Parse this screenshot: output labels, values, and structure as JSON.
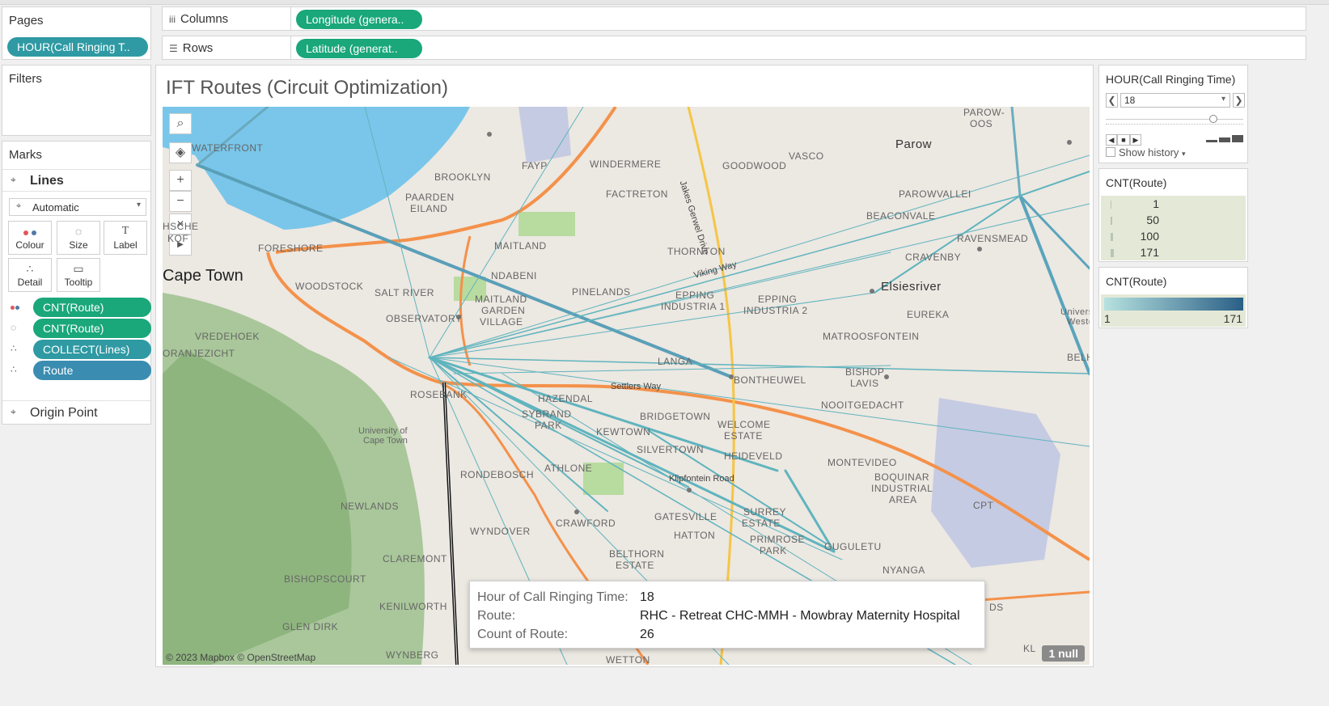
{
  "shelves": {
    "pages": {
      "label": "Pages",
      "pill": "HOUR(Call Ringing T.."
    },
    "columns": {
      "label": "Columns",
      "pill": "Longitude (genera.."
    },
    "rows": {
      "label": "Rows",
      "pill": "Latitude (generat.."
    },
    "filters": {
      "label": "Filters"
    }
  },
  "marks": {
    "label": "Marks",
    "layer1": "Lines",
    "mark_type": "Automatic",
    "buttons": {
      "colour": "Colour",
      "size": "Size",
      "label": "Label",
      "detail": "Detail",
      "tooltip": "Tooltip"
    },
    "fields": [
      "CNT(Route)",
      "CNT(Route)",
      "COLLECT(Lines)",
      "Route"
    ],
    "layer2": "Origin Point"
  },
  "viz": {
    "title": "IFT Routes (Circuit Optimization)",
    "attribution": "© 2023 Mapbox © OpenStreetMap",
    "null_badge": "1 null",
    "places": {
      "waterfront": "WATERFRONT",
      "brooklyn": "BROOKLYN",
      "paarden": "PAARDEN",
      "eiland": "EILAND",
      "fayp": "FAYP",
      "windermere": "WINDERMERE",
      "goodwood": "GOODWOOD",
      "vasco": "VASCO",
      "parow": "Parow",
      "parow_oos": "PAROW-",
      "parow_oos2": "OOS",
      "factreton": "FACTRETON",
      "parowvallei": "PAROWVALLEI",
      "beaconvale": "BEACONVALE",
      "ravensmead": "RAVENSMEAD",
      "cravenby": "CRAVENBY",
      "maitland": "MAITLAND",
      "thornton": "THORNTON",
      "foreshore": "FORESHORE",
      "ndabeni": "NDABENI",
      "pinelands": "PINELANDS",
      "epping1": "EPPING",
      "epping1b": "INDUSTRIA 1",
      "epping2": "EPPING",
      "epping2b": "INDUSTRIA 2",
      "elsiesriver": "Elsiesriver",
      "eureka": "EUREKA",
      "university_w": "University",
      "university_w2": "Western",
      "cape_town": "Cape Town",
      "woodstock": "WOODSTOCK",
      "salt_river": "SALT RIVER",
      "maitland_gv": "MAITLAND",
      "garden": "GARDEN",
      "village": "VILLAGE",
      "observatory": "OBSERVATORY",
      "vredehoek": "VREDEHOEK",
      "oranjezicht": "ORANJEZICHT",
      "matroosfontein": "MATROOSFONTEIN",
      "belhar": "BELH",
      "langa": "LANGA",
      "bontheuwel": "BONTHEUWEL",
      "bishop_lavis": "BISHOP",
      "bishop_lavis2": "LAVIS",
      "rosebank": "ROSEBANK",
      "hazendal": "HAZENDAL",
      "sybrand": "SYBRAND",
      "park": "PARK",
      "settlers": "Settlers Way",
      "nooitgedacht": "NOOITGEDACHT",
      "bridgetown": "BRIDGETOWN",
      "welcome": "WELCOME",
      "estate": "ESTATE",
      "kewtown": "KEWTOWN",
      "uct": "University of",
      "uct2": "Cape Town",
      "silvertown": "SILVERTOWN",
      "heideveld": "HEIDEVELD",
      "rondebosch": "RONDEBOSCH",
      "athlone": "ATHLONE",
      "montevideo": "MONTEVIDEO",
      "boquinar": "BOQUINAR",
      "industrial": "INDUSTRIAL",
      "area": "AREA",
      "cpt": "CPT",
      "klipfontein": "Klipfontein Road",
      "newlands": "NEWLANDS",
      "crawford": "CRAWFORD",
      "gatesville": "GATESVILLE",
      "surrey": "SURREY",
      "surrey2": "ESTATE",
      "hatton": "HATTON",
      "primrose": "PRIMROSE",
      "primrose2": "PARK",
      "gugulethu": "GUGULETU",
      "wyndover": "WYNDOVER",
      "claremont": "CLAREMONT",
      "belthorn": "BELTHORN",
      "belthorn2": "ESTATE",
      "nyanga": "NYANGA",
      "bishopscourt": "BISHOPSCOURT",
      "kenilworth": "KENILWORTH",
      "glen_dirk": "GLEN DIRK",
      "wynberg": "WYNBERG",
      "wetton": "WETTON",
      "jakes": "Jakes Gerwel Drive",
      "viking": "Viking Way",
      "hsche": "HSCHE",
      "kof": "KOF",
      "ds": "DS",
      "kl": "KL"
    }
  },
  "tooltip": {
    "rows": [
      {
        "key": "Hour of Call Ringing Time:",
        "value": "18"
      },
      {
        "key": "Route:",
        "value": "RHC - Retreat CHC-MMH - Mowbray Maternity Hospital"
      },
      {
        "key": "Count of Route:",
        "value": "26"
      }
    ]
  },
  "right_panel": {
    "page_control": {
      "title": "HOUR(Call Ringing Time)",
      "value": "18",
      "show_history": "Show history"
    },
    "size_legend": {
      "title": "CNT(Route)",
      "values": [
        "1",
        "50",
        "100",
        "171"
      ]
    },
    "color_legend": {
      "title": "CNT(Route)",
      "min": "1",
      "max": "171",
      "color_min": "#b7e2e0",
      "color_max": "#2a5f86"
    }
  },
  "colors": {
    "pill_green": "#1aa77a",
    "pill_teal": "#2f9aa3",
    "pill_blue": "#3a8db1",
    "route_line": "#5fb4be",
    "water": "#79c6ea",
    "road": "#f4914a",
    "highway_yellow": "#f6c544"
  }
}
